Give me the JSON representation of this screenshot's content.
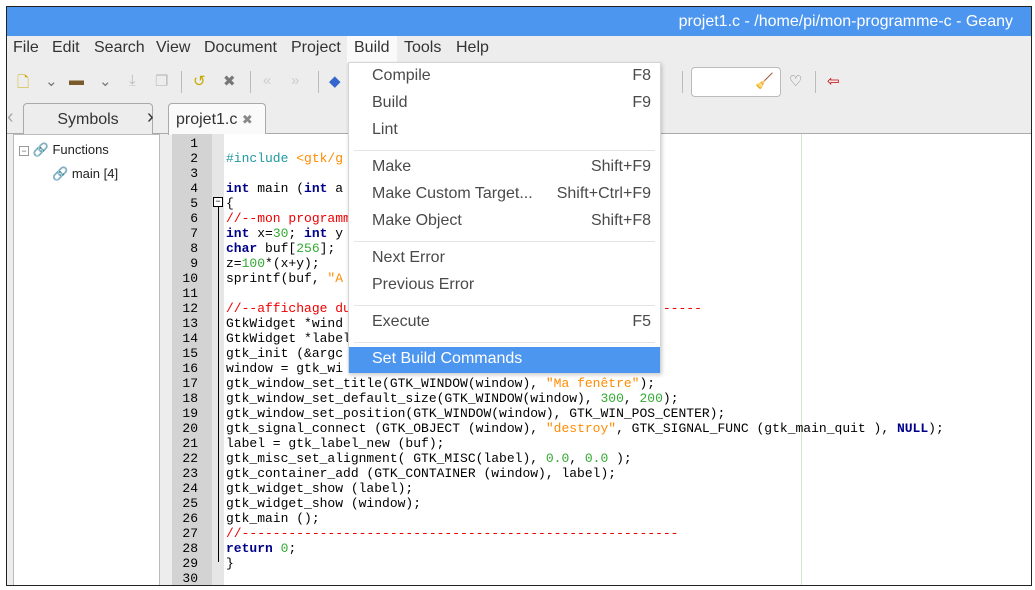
{
  "window": {
    "title": "projet1.c - /home/pi/mon-programme-c - Geany"
  },
  "menubar": [
    "File",
    "Edit",
    "Search",
    "View",
    "Document",
    "Project",
    "Build",
    "Tools",
    "Help"
  ],
  "sidebar": {
    "tab": "Symbols",
    "group": "Functions",
    "items": [
      "main [4]"
    ]
  },
  "editor": {
    "tab": "projet1.c",
    "lines": [
      [],
      [
        [
          "#include ",
          "#1e9aa0"
        ],
        [
          "<gtk/g",
          "#ff8c00"
        ]
      ],
      [],
      [
        [
          "int",
          "#00008b",
          1
        ],
        [
          " main (",
          ""
        ],
        [
          "int",
          "#00008b",
          1
        ],
        [
          " a",
          ""
        ]
      ],
      [
        [
          "{",
          ""
        ]
      ],
      [
        [
          "//--mon programm",
          "#e00"
        ]
      ],
      [
        [
          "int",
          "#00008b",
          1
        ],
        [
          " x=",
          ""
        ],
        [
          "30",
          "#3a3"
        ],
        [
          "; ",
          ""
        ],
        [
          "int",
          "#00008b",
          1
        ],
        [
          " y",
          ""
        ]
      ],
      [
        [
          "char",
          "#00008b",
          1
        ],
        [
          " buf[",
          ""
        ],
        [
          "256",
          "#3a3"
        ],
        [
          "];",
          ""
        ]
      ],
      [
        [
          "z=",
          ""
        ],
        [
          "100",
          "#3a3"
        ],
        [
          "*(x+y);",
          ""
        ]
      ],
      [
        [
          "sprintf(buf, ",
          ""
        ],
        [
          "\"A",
          "#ff8c00"
        ]
      ],
      [],
      [
        [
          "//--affichage du---------------------------------------------",
          "#e00"
        ]
      ],
      [
        [
          "GtkWidget *wind",
          ""
        ]
      ],
      [
        [
          "GtkWidget *label",
          ""
        ]
      ],
      [
        [
          "gtk_init (&argc",
          ""
        ]
      ],
      [
        [
          "window = gtk_wi",
          ""
        ]
      ],
      [
        [
          "gtk_window_set_title(GTK_WINDOW(window), ",
          ""
        ],
        [
          "\"Ma fenêtre\"",
          "#ff8c00"
        ],
        [
          ");",
          ""
        ]
      ],
      [
        [
          "gtk_window_set_default_size(GTK_WINDOW(window), ",
          ""
        ],
        [
          "300",
          "#3a3"
        ],
        [
          ", ",
          ""
        ],
        [
          "200",
          "#3a3"
        ],
        [
          ");",
          ""
        ]
      ],
      [
        [
          "gtk_window_set_position(GTK_WINDOW(window), GTK_WIN_POS_CENTER);",
          ""
        ]
      ],
      [
        [
          "gtk_signal_connect (GTK_OBJECT (window), ",
          ""
        ],
        [
          "\"destroy\"",
          "#ff8c00"
        ],
        [
          ", GTK_SIGNAL_FUNC (gtk_main_quit ), ",
          ""
        ],
        [
          "NULL",
          "#00008b",
          1
        ],
        [
          ");",
          ""
        ]
      ],
      [
        [
          "label = gtk_label_new (buf);",
          ""
        ]
      ],
      [
        [
          "gtk_misc_set_alignment( GTK_MISC(label), ",
          ""
        ],
        [
          "0.0",
          "#3a3"
        ],
        [
          ", ",
          ""
        ],
        [
          "0.0",
          "#3a3"
        ],
        [
          " );",
          ""
        ]
      ],
      [
        [
          "gtk_container_add (GTK_CONTAINER (window), label);",
          ""
        ]
      ],
      [
        [
          "gtk_widget_show (label);",
          ""
        ]
      ],
      [
        [
          "gtk_widget_show (window);",
          ""
        ]
      ],
      [
        [
          "gtk_main ();",
          ""
        ]
      ],
      [
        [
          "//--------------------------------------------------------",
          "#e00"
        ]
      ],
      [
        [
          "return",
          "#00008b",
          1
        ],
        [
          " ",
          ""
        ],
        [
          "0",
          "#3a3"
        ],
        [
          ";",
          ""
        ]
      ],
      [
        [
          "}",
          ""
        ]
      ],
      []
    ]
  },
  "build_menu": [
    {
      "label": "Compile",
      "key": "F8"
    },
    {
      "label": "Build",
      "key": "F9"
    },
    {
      "label": "Lint",
      "key": ""
    },
    "sep",
    {
      "label": "Make",
      "key": "Shift+F9"
    },
    {
      "label": "Make Custom Target...",
      "key": "Shift+Ctrl+F9"
    },
    {
      "label": "Make Object",
      "key": "Shift+F8"
    },
    "sep",
    {
      "label": "Next Error",
      "key": ""
    },
    {
      "label": "Previous Error",
      "key": ""
    },
    "sep",
    {
      "label": "Execute",
      "key": "F5"
    },
    "sep",
    {
      "label": "Set Build Commands",
      "key": "",
      "selected": true
    }
  ],
  "colors": {
    "accent": "#4d96ef"
  }
}
